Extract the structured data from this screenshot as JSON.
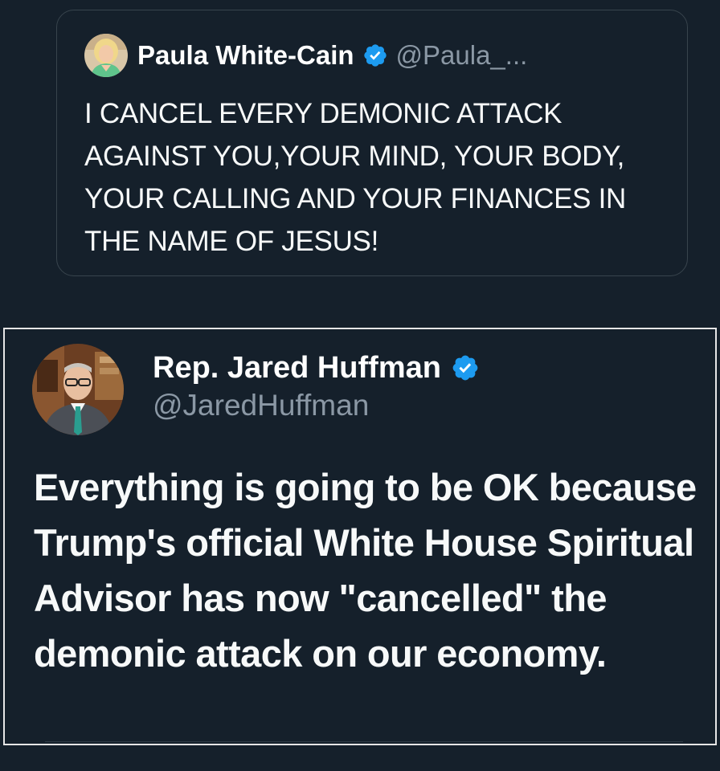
{
  "quoted_tweet": {
    "author_name": "Paula White-Cain",
    "handle": "@Paula_...",
    "verified": true,
    "verified_badge_color": "#1d9bf0",
    "text": "I CANCEL EVERY DEMONIC ATTACK AGAINST YOU,YOUR MIND, YOUR BODY, YOUR CALLING AND YOUR FINANCES IN THE NAME OF JESUS!"
  },
  "main_tweet": {
    "author_name": "Rep. Jared Huffman",
    "handle": "@JaredHuffman",
    "verified": true,
    "verified_badge_color": "#1d9bf0",
    "text": "Everything is going to be OK because Trump's official White House Spiritual Advisor has now \"cancelled\" the demonic attack on our economy."
  },
  "colors": {
    "background": "#15202b",
    "text_primary": "#f7f9f9",
    "text_secondary": "#8b98a5",
    "quoted_border": "#38444d",
    "main_border": "#e6e6e6"
  },
  "icons": {
    "verified": "verified-badge-icon",
    "quoted_avatar": "avatar-photo",
    "main_avatar": "avatar-photo"
  }
}
